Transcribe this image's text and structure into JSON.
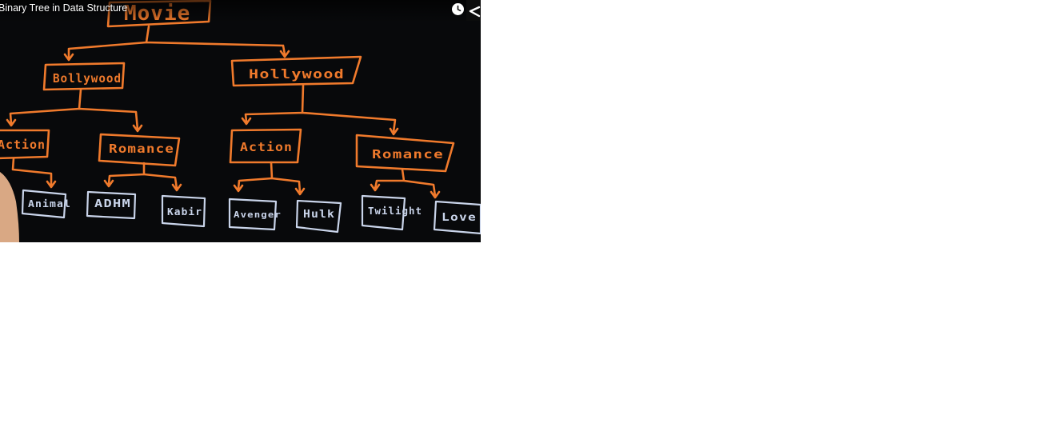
{
  "video": {
    "title": "Binary Tree in Data Structure"
  },
  "tree": {
    "root": "Movie",
    "level1": [
      "Bollywood",
      "Hollywood"
    ],
    "level2": [
      "Action",
      "Romance",
      "Action",
      "Romance"
    ],
    "leaves": [
      "Animal",
      "ADHM",
      "Kabir",
      "Avenger",
      "Hulk",
      "Twilight",
      "Love"
    ]
  },
  "colors": {
    "board": "#08090b",
    "orange_chalk": "#f07a2c",
    "white_chalk": "#c9d4ea"
  },
  "icons": {
    "watch_later": "clock-icon",
    "share": "share-icon"
  }
}
